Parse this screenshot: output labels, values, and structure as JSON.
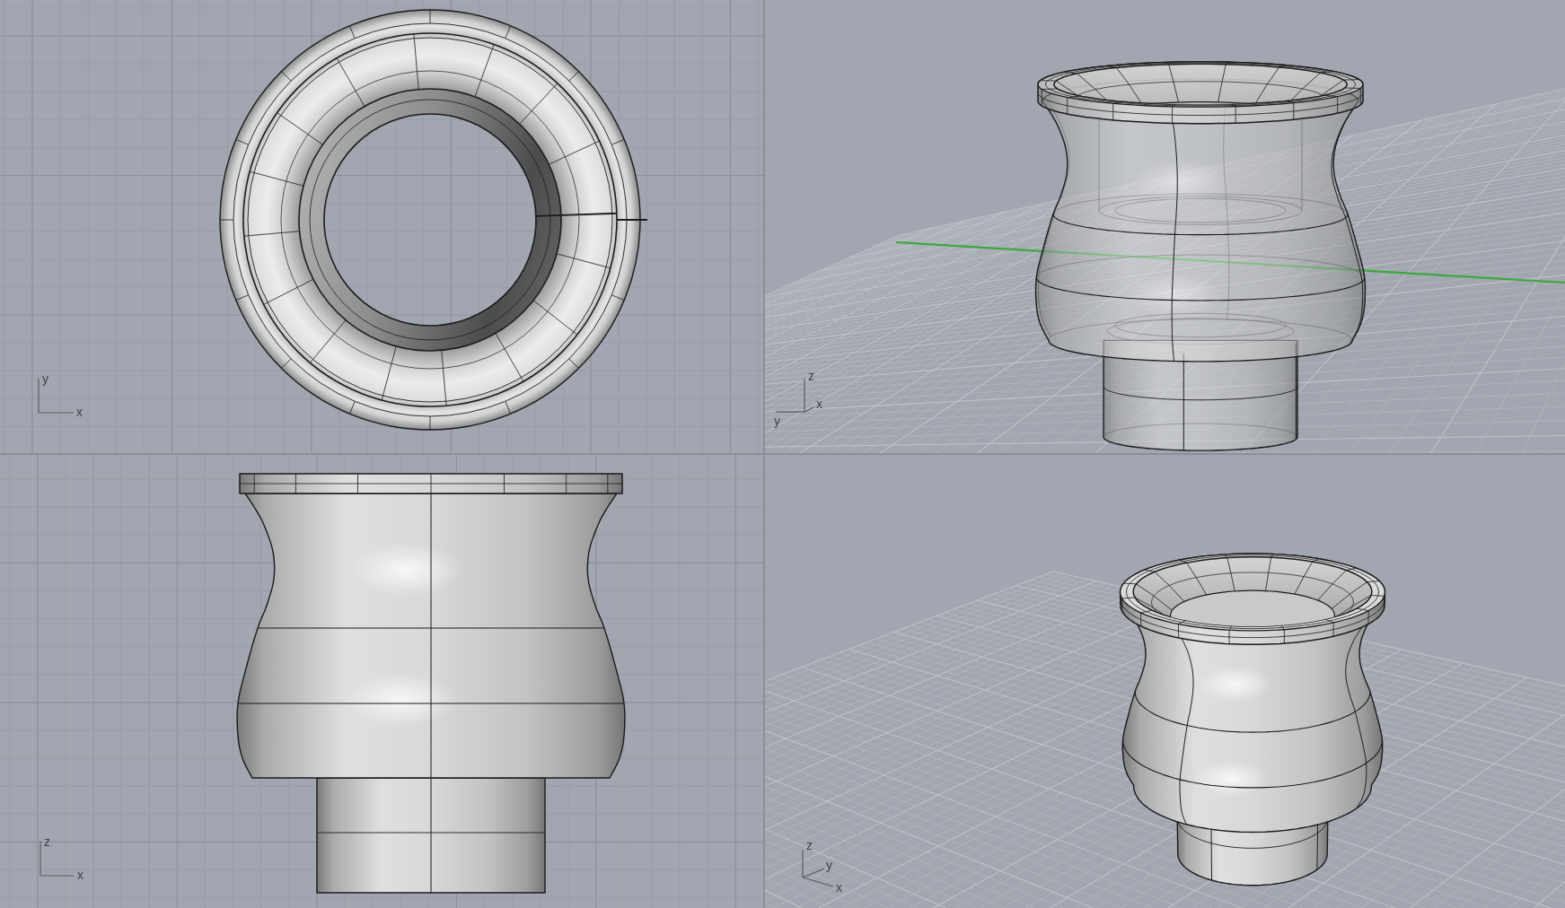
{
  "viewports": [
    {
      "kind": "top",
      "ghosted": false,
      "world_axis": false,
      "axis_labels": [
        {
          "kind": "vertical",
          "text": "y"
        },
        {
          "kind": "horizontal",
          "text": "x"
        }
      ]
    },
    {
      "kind": "perspective",
      "ghosted": true,
      "world_axis": true,
      "axis_labels": [
        {
          "kind": "vertical",
          "text": "z"
        },
        {
          "kind": "depth",
          "text": "y"
        },
        {
          "kind": "horizontal",
          "text": "x"
        }
      ]
    },
    {
      "kind": "front",
      "ghosted": false,
      "world_axis": false,
      "axis_labels": [
        {
          "kind": "vertical",
          "text": "z"
        },
        {
          "kind": "horizontal",
          "text": "x"
        }
      ]
    },
    {
      "kind": "perspective",
      "ghosted": false,
      "world_axis": false,
      "axis_labels": [
        {
          "kind": "vertical",
          "text": "z"
        },
        {
          "kind": "depth",
          "text": "y"
        },
        {
          "kind": "horizontal",
          "text": "x"
        }
      ]
    }
  ]
}
